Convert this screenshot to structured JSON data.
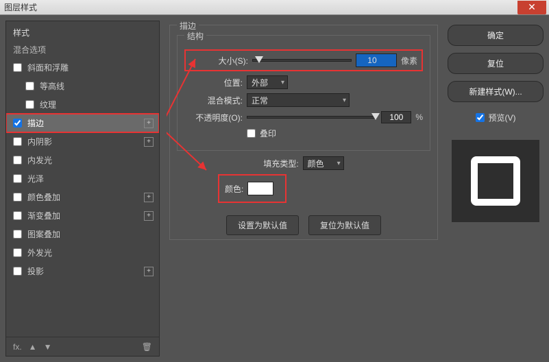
{
  "title": "图层样式",
  "sidebar": {
    "header": "样式",
    "blend_options": "混合选项",
    "items": [
      {
        "label": "斜面和浮雕",
        "checked": false,
        "plus": false,
        "indent": false
      },
      {
        "label": "等高线",
        "checked": false,
        "plus": false,
        "indent": true
      },
      {
        "label": "纹理",
        "checked": false,
        "plus": false,
        "indent": true
      },
      {
        "label": "描边",
        "checked": true,
        "plus": true,
        "indent": false,
        "selected": true
      },
      {
        "label": "内阴影",
        "checked": false,
        "plus": true,
        "indent": false
      },
      {
        "label": "内发光",
        "checked": false,
        "plus": false,
        "indent": false
      },
      {
        "label": "光泽",
        "checked": false,
        "plus": false,
        "indent": false
      },
      {
        "label": "颜色叠加",
        "checked": false,
        "plus": true,
        "indent": false
      },
      {
        "label": "渐变叠加",
        "checked": false,
        "plus": true,
        "indent": false
      },
      {
        "label": "图案叠加",
        "checked": false,
        "plus": false,
        "indent": false
      },
      {
        "label": "外发光",
        "checked": false,
        "plus": false,
        "indent": false
      },
      {
        "label": "投影",
        "checked": false,
        "plus": true,
        "indent": false
      }
    ]
  },
  "stroke": {
    "panel_label": "描边",
    "structure_label": "结构",
    "size_label": "大小(S):",
    "size_value": "10",
    "size_unit": "像素",
    "position_label": "位置:",
    "position_value": "外部",
    "blend_label": "混合模式:",
    "blend_value": "正常",
    "opacity_label": "不透明度(O):",
    "opacity_value": "100",
    "opacity_unit": "%",
    "overprint_label": "叠印",
    "fill_type_label": "填充类型:",
    "fill_type_value": "颜色",
    "color_label": "颜色:",
    "color_value": "#ffffff",
    "btn_default": "设置为默认值",
    "btn_reset": "复位为默认值"
  },
  "right": {
    "ok": "确定",
    "cancel": "复位",
    "new_style": "新建样式(W)...",
    "preview": "预览(V)"
  }
}
